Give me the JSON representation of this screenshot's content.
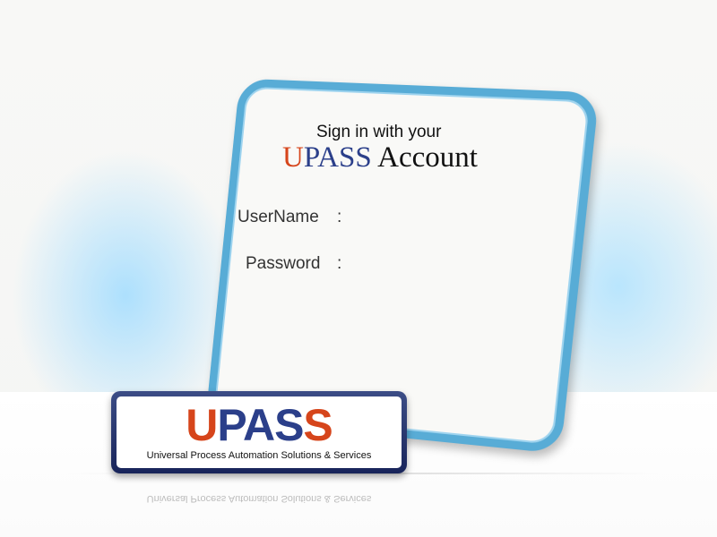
{
  "signin": {
    "line1": "Sign in with your",
    "brand_u": "U",
    "brand_pass": "PASS",
    "account": " Account"
  },
  "form": {
    "username_label": "UserName",
    "password_label": "Password",
    "colon": ":",
    "username_value": "",
    "password_value": ""
  },
  "logo": {
    "u": "U",
    "pa": "PA",
    "s1": "S",
    "s2": "S",
    "subtitle": "Universal Process Automation Solutions & Services"
  },
  "colors": {
    "card_border": "#58acd6",
    "brand_red": "#d6451b",
    "brand_blue": "#2b3f8a",
    "plate": "#18245a"
  }
}
